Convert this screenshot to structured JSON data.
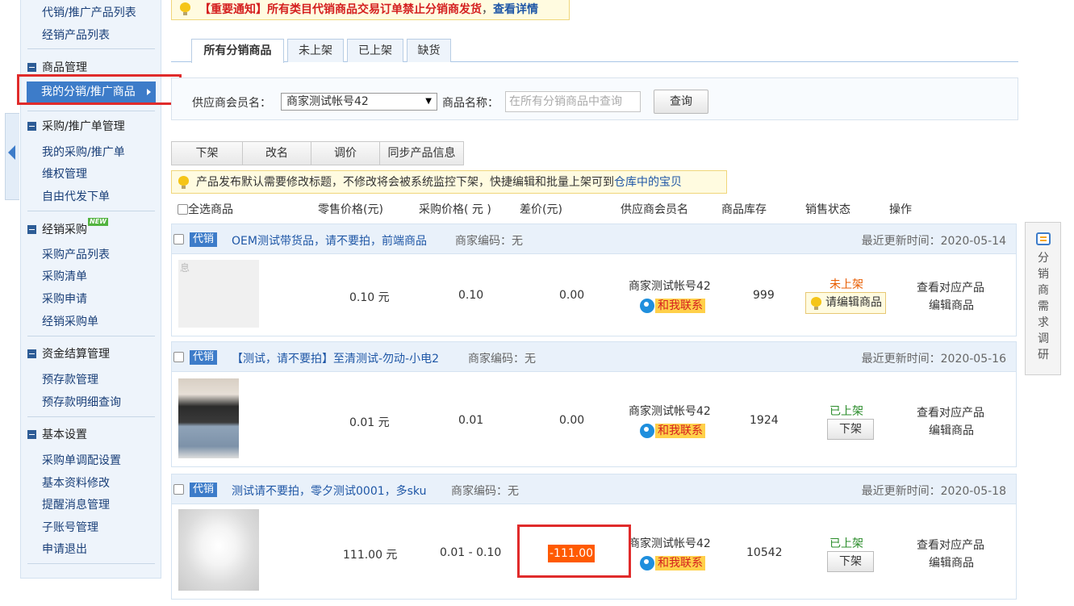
{
  "notice": {
    "prefix": "【重要通知】所有类目代销商品交易订单",
    "emph": "禁止分销商发货",
    "comma": "，",
    "link": "查看详情"
  },
  "sidebar": {
    "top_items": [
      "代销/推广产品列表",
      "经销产品列表"
    ],
    "sections": [
      {
        "title": "商品管理",
        "items": [
          "我的分销/推广商品"
        ]
      },
      {
        "title": "采购/推广单管理",
        "items": [
          "我的采购/推广单",
          "维权管理",
          "自由代发下单"
        ]
      },
      {
        "title": "经销采购",
        "badge": "NEW",
        "items": [
          "采购产品列表",
          "采购清单",
          "采购申请",
          "经销采购单"
        ]
      },
      {
        "title": "资金结算管理",
        "items": [
          "预存款管理",
          "预存款明细查询"
        ]
      },
      {
        "title": "基本设置",
        "items": [
          "采购单调配设置",
          "基本资料修改",
          "提醒消息管理",
          "子账号管理",
          "申请退出"
        ]
      }
    ]
  },
  "tabs": [
    "所有分销商品",
    "未上架",
    "已上架",
    "缺货"
  ],
  "search": {
    "supplier_label": "供应商会员名：",
    "supplier_value": "商家测试帐号42",
    "name_label": "商品名称：",
    "name_placeholder": "在所有分销商品中查询",
    "query_label": "查询"
  },
  "toolbar": [
    "下架",
    "改名",
    "调价",
    "同步产品信息"
  ],
  "tip": {
    "text": "产品发布默认需要修改标题，不修改将会被系统监控下架，快捷编辑和批量上架可到",
    "link": "仓库中的宝贝"
  },
  "columns": {
    "select_all": "全选商品",
    "retail": "零售价格(元)",
    "purchase": "采购价格( 元 )",
    "diff": "差价(元)",
    "supplier": "供应商会员名",
    "stock": "商品库存",
    "status": "销售状态",
    "ops": "操作"
  },
  "products": [
    {
      "tag": "代销",
      "title": "OEM测试带货品，请不要拍，前端商品",
      "code_label": "商家编码：",
      "code": "无",
      "updated_label": "最近更新时间：",
      "updated": "2020-05-14",
      "retail": "0.10 元",
      "purchase": "0.10",
      "diff": "0.00",
      "supplier": "商家测试帐号42",
      "contact": "和我联系",
      "stock": "999",
      "status": "未上架",
      "status_action": "请编辑商品",
      "op1": "查看对应产品",
      "op2": "编辑商品",
      "thumb_text": "息"
    },
    {
      "tag": "代销",
      "title": "【测试，请不要拍】至清测试-勿动-小电2",
      "code_label": "商家编码：",
      "code": "无",
      "updated_label": "最近更新时间：",
      "updated": "2020-05-16",
      "retail": "0.01 元",
      "purchase": "0.01",
      "diff": "0.00",
      "supplier": "商家测试帐号42",
      "contact": "和我联系",
      "stock": "1924",
      "status": "已上架",
      "status_action": "下架",
      "op1": "查看对应产品",
      "op2": "编辑商品"
    },
    {
      "tag": "代销",
      "title": "测试请不要拍，零夕测试0001，多sku",
      "code_label": "商家编码：",
      "code": "无",
      "updated_label": "最近更新时间：",
      "updated": "2020-05-18",
      "retail": "111.00 元",
      "purchase": "0.01 - 0.10",
      "diff": "-111.00",
      "supplier": "商家测试帐号42",
      "contact": "和我联系",
      "stock": "10542",
      "status": "已上架",
      "status_action": "下架",
      "op1": "查看对应产品",
      "op2": "编辑商品"
    }
  ],
  "survey": "分销商需求调研",
  "colors": {
    "accent": "#3d7cc9",
    "link": "#1f57a6",
    "highlight_red": "#e02b2b",
    "negative": "#ff5a00"
  }
}
